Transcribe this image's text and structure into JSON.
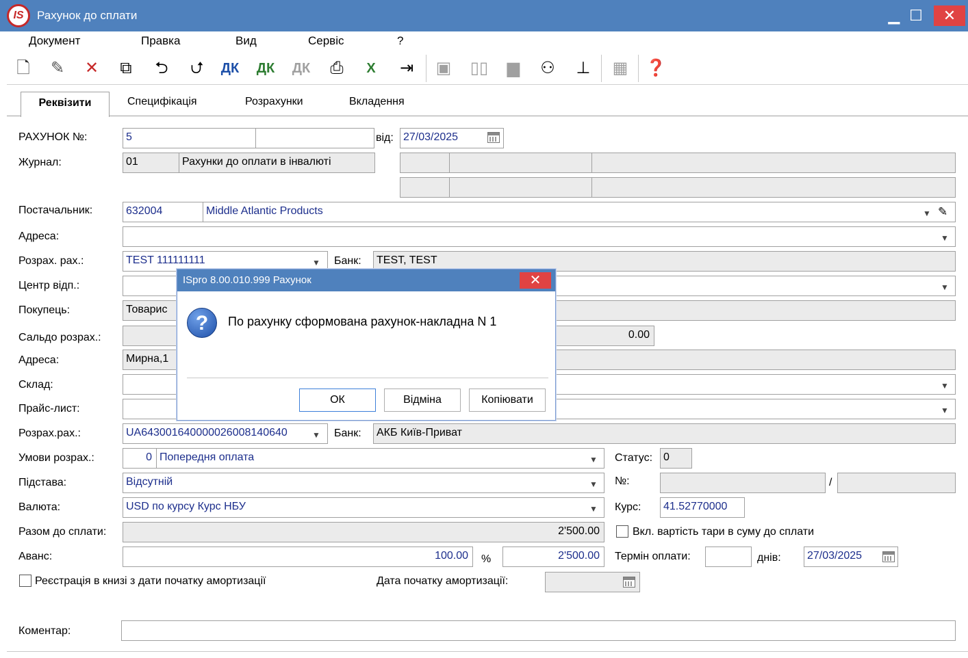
{
  "window": {
    "title": "Рахунок до сплати",
    "logo_text": "IS"
  },
  "menu": [
    "Документ",
    "Правка",
    "Вид",
    "Сервіс",
    "?"
  ],
  "tabs": [
    "Реквізити",
    "Специфікація",
    "Розрахунки",
    "Вкладення"
  ],
  "form": {
    "invoice_no_label": "РАХУНОК №:",
    "invoice_no": "5",
    "date_label": "від:",
    "date": "27/03/2025",
    "journal_label": "Журнал:",
    "journal_code": "01",
    "journal_name": "Рахунки до оплати в інвалюті",
    "supplier_label": "Постачальник:",
    "supplier_code": "632004",
    "supplier_name": "Middle Atlantic Products",
    "address_label": "Адреса:",
    "account_label": "Розрах. рах.:",
    "account": "TEST 111111111",
    "bank_label": "Банк:",
    "bank": "TEST, TEST",
    "center_label": "Центр відп.:",
    "buyer_label": "Покупець:",
    "buyer": "Товарис",
    "saldo_label": "Сальдо розрах.:",
    "saldo": "0.00",
    "buyer_address_label": "Адреса:",
    "buyer_address": "Мирна,1",
    "warehouse_label": "Склад:",
    "pricelist_label": "Прайс-лист:",
    "account2_label": "Розрах.рах.:",
    "account2": "UA643001640000026008140640",
    "bank2_label": "Банк:",
    "bank2": "АКБ Київ-Приват",
    "terms_label": "Умови розрах.:",
    "terms_code": "0",
    "terms_name": "Попередня оплата",
    "status_label": "Статус:",
    "status": "0",
    "basis_label": "Підстава:",
    "basis": "Відсутній",
    "no_label": "№:",
    "slash": "/",
    "currency_label": "Валюта:",
    "currency": "USD по курсу Курс НБУ",
    "rate_label": "Курс:",
    "rate": "41.52770000",
    "total_label": "Разом до сплати:",
    "total": "2'500.00",
    "tare_label": "Вкл. вартість тари в суму до сплати",
    "advance_label": "Аванс:",
    "advance_pct": "100.00",
    "pct_sign": "%",
    "advance_sum": "2'500.00",
    "pay_term_label": "Термін оплати:",
    "days_label": "днів:",
    "pay_date": "27/03/2025",
    "register_label": "Реєстрація в книзі з дати початку амортизації",
    "amort_date_label": "Дата початку амортизації:",
    "comment_label": "Коментар:"
  },
  "dialog": {
    "title": "ISpro 8.00.010.999 Рахунок",
    "message": "По рахунку сформована рахунок-накладна N 1",
    "ok": "ОК",
    "cancel": "Відміна",
    "copy": "Копіювати"
  },
  "icons": {
    "toolbar": [
      "new-doc-icon",
      "edit-doc-icon",
      "delete-doc-icon",
      "copy-doc-icon",
      "import-doc-icon",
      "export-doc-icon",
      "debit-credit-icon",
      "debit-credit-green-icon",
      "debit-credit-disabled-icon",
      "print-icon",
      "excel-icon",
      "exit-icon",
      "save-icon",
      "book-icon",
      "folder-icon",
      "users-icon",
      "hierarchy-icon",
      "grid-icon",
      "help-icon"
    ]
  }
}
